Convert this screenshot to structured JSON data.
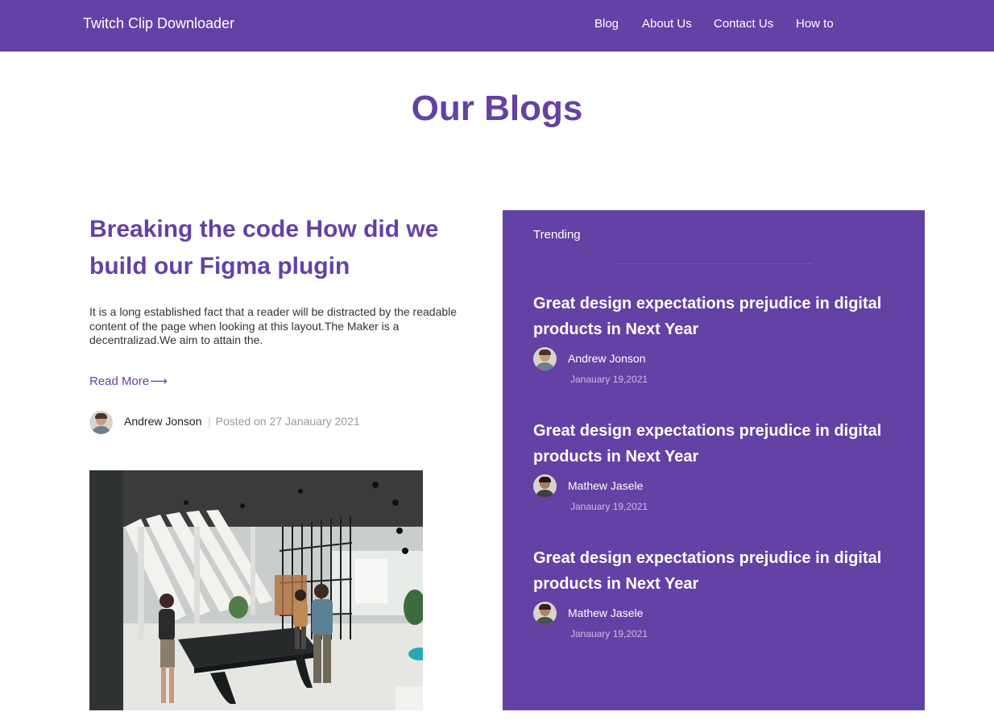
{
  "header": {
    "brand": "Twitch Clip Downloader",
    "nav": [
      {
        "label": "Blog"
      },
      {
        "label": "About Us"
      },
      {
        "label": "Contact Us"
      },
      {
        "label": "How to"
      }
    ]
  },
  "page": {
    "title": "Our Blogs"
  },
  "featured_post": {
    "title": "Breaking the code How did we build our Figma plugin",
    "excerpt": "It is a long established fact that a reader will be distracted by the readable content of the page when looking at this layout.The Maker is a decentralizad.We aim to attain the.",
    "read_more": "Read More",
    "read_more_arrow": "⟶",
    "author": "Andrew Jonson",
    "separator": "|",
    "posted_on": "Posted on 27 Janauary 2021"
  },
  "trending": {
    "heading": "Trending",
    "items": [
      {
        "title": "Great design expectations prejudice in digital products in Next Year",
        "author": "Andrew Jonson",
        "date": "Janauary 19,2021"
      },
      {
        "title": "Great design expectations prejudice in digital products in Next Year",
        "author": "Mathew Jasele",
        "date": "Janauary 19,2021"
      },
      {
        "title": "Great design expectations prejudice in digital products in Next Year",
        "author": "Mathew Jasele",
        "date": "Janauary 19,2021"
      }
    ]
  },
  "colors": {
    "brand_purple": "#6441a5",
    "white": "#ffffff",
    "text_dark": "#333333",
    "text_muted": "#9a9a9a"
  }
}
